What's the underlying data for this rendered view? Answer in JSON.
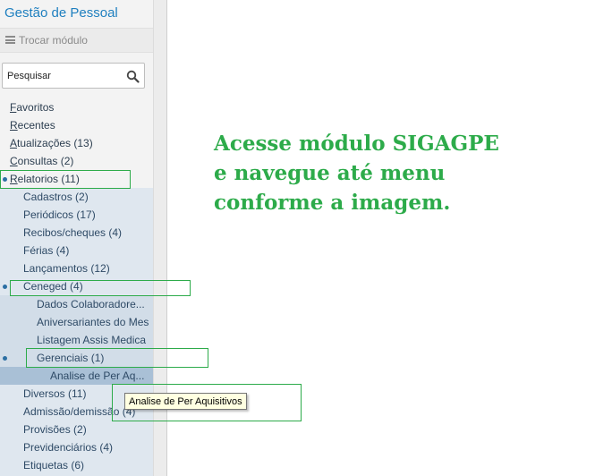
{
  "module_title": "Gestão de Pessoal",
  "switch_module": "Trocar módulo",
  "search": {
    "placeholder": "Pesquisar"
  },
  "menu": {
    "top": [
      {
        "accel": "F",
        "rest": "avoritos"
      },
      {
        "accel": "R",
        "rest": "ecentes"
      },
      {
        "accel": "A",
        "rest": "tualizações (13)"
      },
      {
        "accel": "C",
        "rest": "onsultas (2)"
      },
      {
        "accel": "R",
        "rest": "elatorios (11)"
      }
    ],
    "relatorios": [
      "Cadastros (2)",
      "Periódicos (17)",
      "Recibos/cheques (4)",
      "Férias (4)",
      "Lançamentos (12)",
      "Ceneged (4)"
    ],
    "ceneged": [
      "Dados Colaboradore...",
      "Aniversariantes do Mes",
      "Listagem Assis Medica",
      "Gerenciais (1)"
    ],
    "gerenciais": [
      "Analise de Per Aq..."
    ],
    "relatorios_after": [
      "Diversos (11)",
      "Admissão/demissão (4)",
      "Provisões (2)",
      "Previdenciários (4)",
      "Etiquetas (6)"
    ]
  },
  "tooltip": "Analise de Per Aquisitivos",
  "instruction": [
    "Acesse módulo SIGAGPE",
    "e navegue até menu",
    "conforme a imagem."
  ],
  "colors": {
    "accent_title": "#1e7fbf",
    "highlight_green": "#2dab4a",
    "selected_item": "#a9c0d6"
  }
}
